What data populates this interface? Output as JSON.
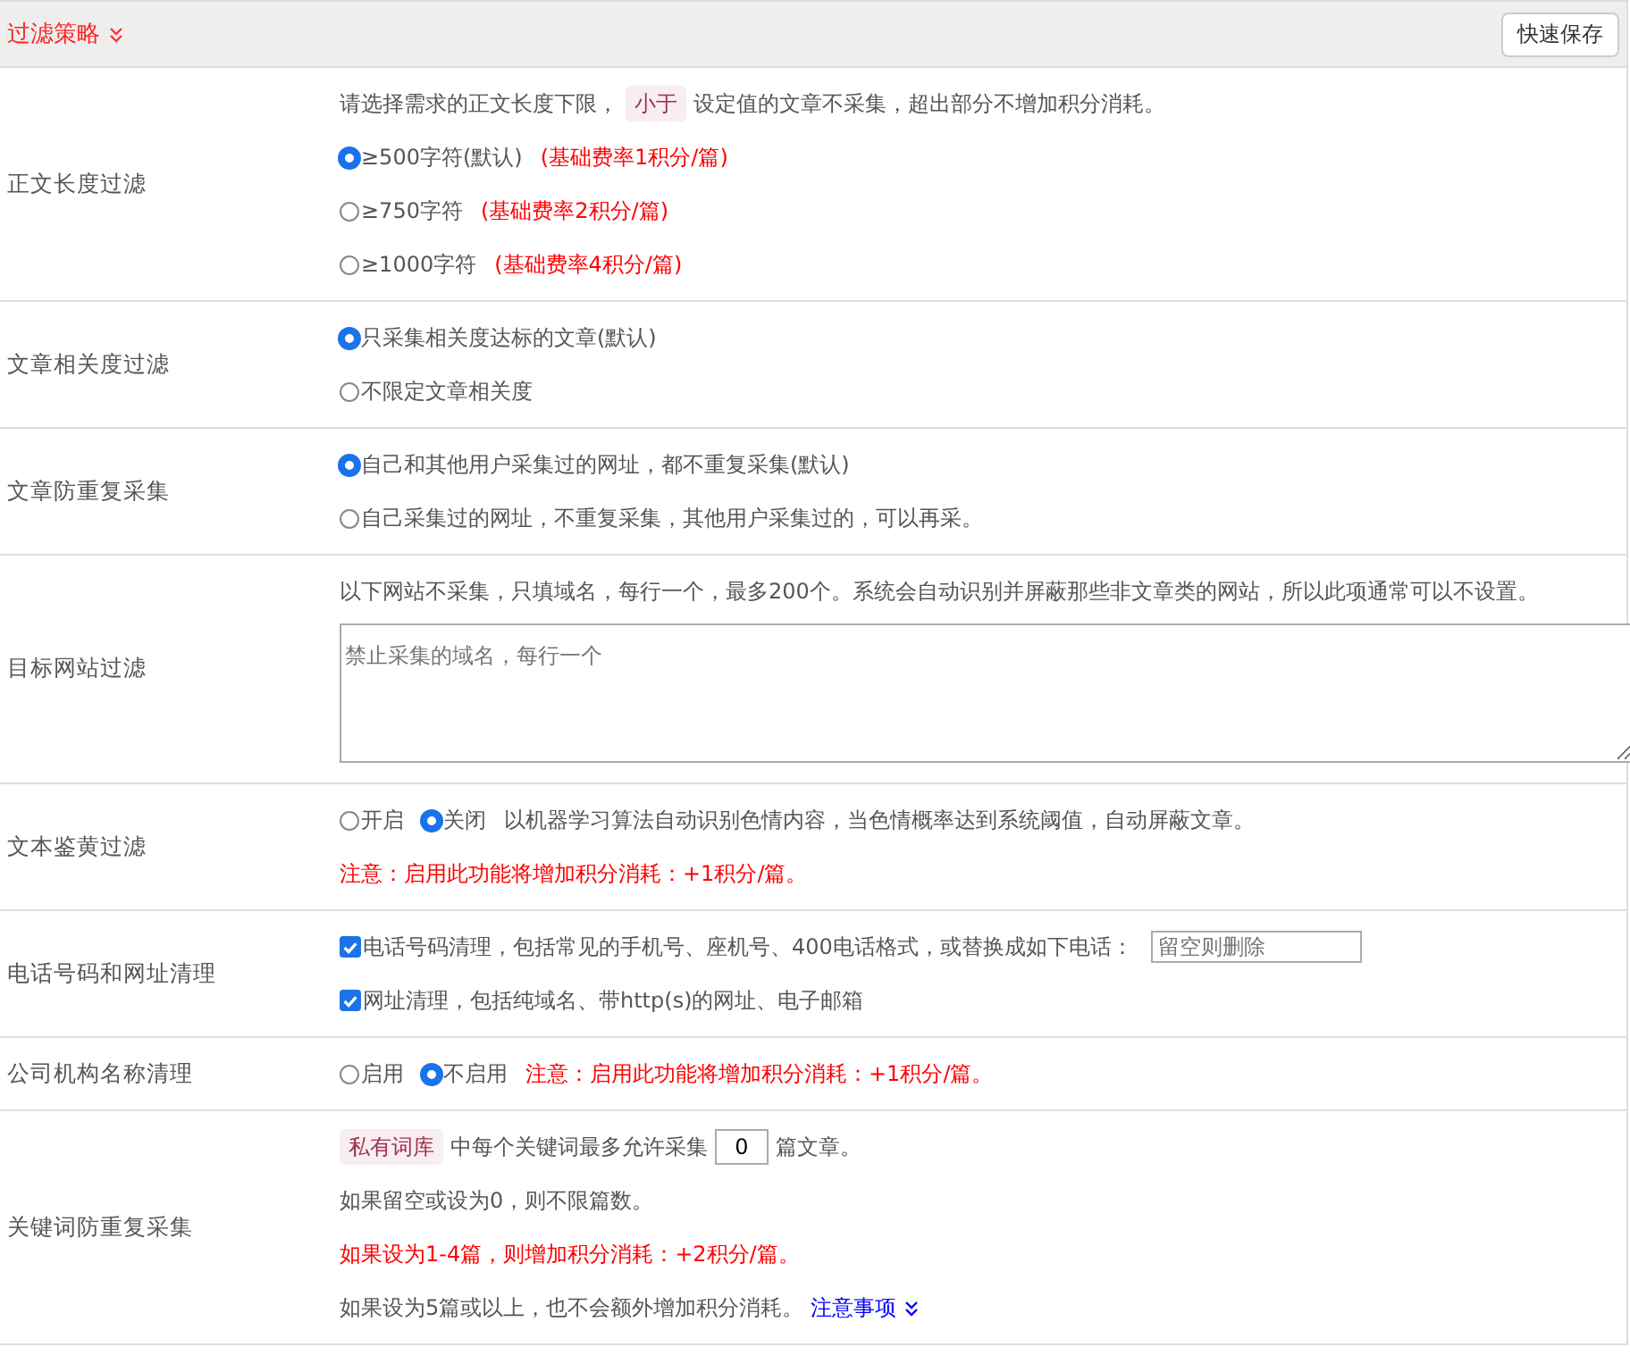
{
  "header": {
    "title": "过滤策略",
    "save_button": "快速保存"
  },
  "sections": [
    {
      "label": "正文长度过滤",
      "lines": [
        [
          {
            "kind": "text",
            "text": "请选择需求的正文长度下限，"
          },
          {
            "kind": "tag",
            "text": "小于"
          },
          {
            "kind": "text",
            "text": "设定值的文章不采集，超出部分不增加积分消耗。"
          }
        ],
        [
          {
            "kind": "radio",
            "text": "≥500字符(默认)",
            "selected": true
          },
          {
            "kind": "note",
            "text": "(基础费率1积分/篇)"
          }
        ],
        [
          {
            "kind": "radio",
            "text": "≥750字符",
            "selected": false
          },
          {
            "kind": "note",
            "text": "(基础费率2积分/篇)"
          }
        ],
        [
          {
            "kind": "radio",
            "text": "≥1000字符",
            "selected": false
          },
          {
            "kind": "note",
            "text": "(基础费率4积分/篇)"
          }
        ]
      ]
    },
    {
      "label": "文章相关度过滤",
      "lines": [
        [
          {
            "kind": "radio",
            "text": "只采集相关度达标的文章(默认)",
            "selected": true
          }
        ],
        [
          {
            "kind": "radio",
            "text": "不限定文章相关度",
            "selected": false
          }
        ]
      ]
    },
    {
      "label": "文章防重复采集",
      "lines": [
        [
          {
            "kind": "radio",
            "text": "自己和其他用户采集过的网址，都不重复采集(默认)",
            "selected": true
          }
        ],
        [
          {
            "kind": "radio",
            "text": "自己采集过的网址，不重复采集，其他用户采集过的，可以再采。",
            "selected": false
          }
        ]
      ]
    },
    {
      "label": "目标网站过滤",
      "lines": [
        [
          {
            "kind": "text",
            "text": "以下网站不采集，只填域名，每行一个，最多200个。系统会自动识别并屏蔽那些非文章类的网站，所以此项通常可以不设置。"
          }
        ],
        [
          {
            "kind": "textarea",
            "placeholder": "禁止采集的域名，每行一个"
          }
        ]
      ]
    },
    {
      "label": "文本鉴黄过滤",
      "lines": [
        [
          {
            "kind": "radio",
            "text": "开启",
            "selected": false
          },
          {
            "kind": "radio",
            "text": "关闭",
            "selected": true
          },
          {
            "kind": "text",
            "text": "以机器学习算法自动识别色情内容，当色情概率达到系统阈值，自动屏蔽文章。"
          }
        ],
        [
          {
            "kind": "note",
            "text": "注意：启用此功能将增加积分消耗：+1积分/篇。"
          }
        ]
      ]
    },
    {
      "label": "电话号码和网址清理",
      "lines": [
        [
          {
            "kind": "checkbox",
            "text": "电话号码清理，包括常见的手机号、座机号、400电话格式，或替换成如下电话：",
            "checked": true
          },
          {
            "kind": "input",
            "placeholder": "留空则删除"
          }
        ],
        [
          {
            "kind": "checkbox",
            "text": "网址清理，包括纯域名、带http(s)的网址、电子邮箱",
            "checked": true
          }
        ]
      ]
    },
    {
      "label": "公司机构名称清理",
      "lines": [
        [
          {
            "kind": "radio",
            "text": "启用",
            "selected": false
          },
          {
            "kind": "radio",
            "text": "不启用",
            "selected": true
          },
          {
            "kind": "note",
            "text": "注意：启用此功能将增加积分消耗：+1积分/篇。"
          }
        ]
      ]
    },
    {
      "label": "关键词防重复采集",
      "lines": [
        [
          {
            "kind": "tag",
            "text": "私有词库"
          },
          {
            "kind": "text",
            "text": "中每个关键词最多允许采集"
          },
          {
            "kind": "number",
            "value": "0"
          },
          {
            "kind": "text",
            "text": "篇文章。"
          }
        ],
        [
          {
            "kind": "text",
            "text": "如果留空或设为0，则不限篇数。"
          }
        ],
        [
          {
            "kind": "note",
            "text": "如果设为1-4篇，则增加积分消耗：+2积分/篇。"
          }
        ],
        [
          {
            "kind": "text",
            "text": "如果设为5篇或以上，也不会额外增加积分消耗。"
          },
          {
            "kind": "link",
            "text": "注意事项"
          }
        ]
      ]
    }
  ]
}
